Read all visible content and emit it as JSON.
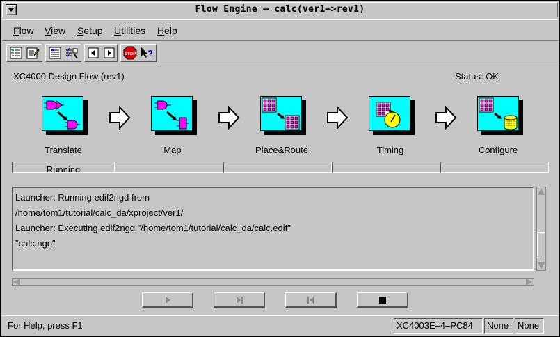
{
  "window": {
    "title": "Flow Engine – calc(ver1–>rev1)"
  },
  "menu": [
    {
      "label": "Flow",
      "mnemonic": "F",
      "rest": "low"
    },
    {
      "label": "View",
      "mnemonic": "V",
      "rest": "iew"
    },
    {
      "label": "Setup",
      "mnemonic": "S",
      "rest": "etup"
    },
    {
      "label": "Utilities",
      "mnemonic": "U",
      "rest": "tilities"
    },
    {
      "label": "Help",
      "mnemonic": "H",
      "rest": "elp"
    }
  ],
  "toolbar": {
    "icons": [
      "checklist-icon",
      "edit-options-icon",
      "report-icon",
      "verify-icon",
      "step-back-icon",
      "step-forward-icon",
      "stop-icon",
      "context-help-icon"
    ],
    "stop_text": "STOP"
  },
  "flow": {
    "title": "XC4000 Design Flow (rev1)",
    "status": "Status: OK",
    "stages": [
      {
        "label": "Translate",
        "state": "Running"
      },
      {
        "label": "Map",
        "state": ""
      },
      {
        "label": "Place&Route",
        "state": ""
      },
      {
        "label": "Timing",
        "state": ""
      },
      {
        "label": "Configure",
        "state": ""
      }
    ]
  },
  "log": {
    "lines": [
      "Launcher: Running edif2ngd from",
      "/home/tom1/tutorial/calc_da/xproject/ver1/",
      "Launcher: Executing edif2ngd \"/home/tom1/tutorial/calc_da/calc.edif\"",
      "\"calc.ngo\""
    ]
  },
  "controls": [
    "play-icon",
    "step-to-end-icon",
    "step-to-start-icon",
    "stop-square-icon"
  ],
  "statusbar": {
    "help": "For Help, press F1",
    "device": "XC4003E–4–PC84",
    "field2": "None",
    "field3": "None"
  },
  "colors": {
    "stage_bg": "#00ffff",
    "window_bg": "#c6c6c6",
    "magenta": "#ff00ff"
  }
}
